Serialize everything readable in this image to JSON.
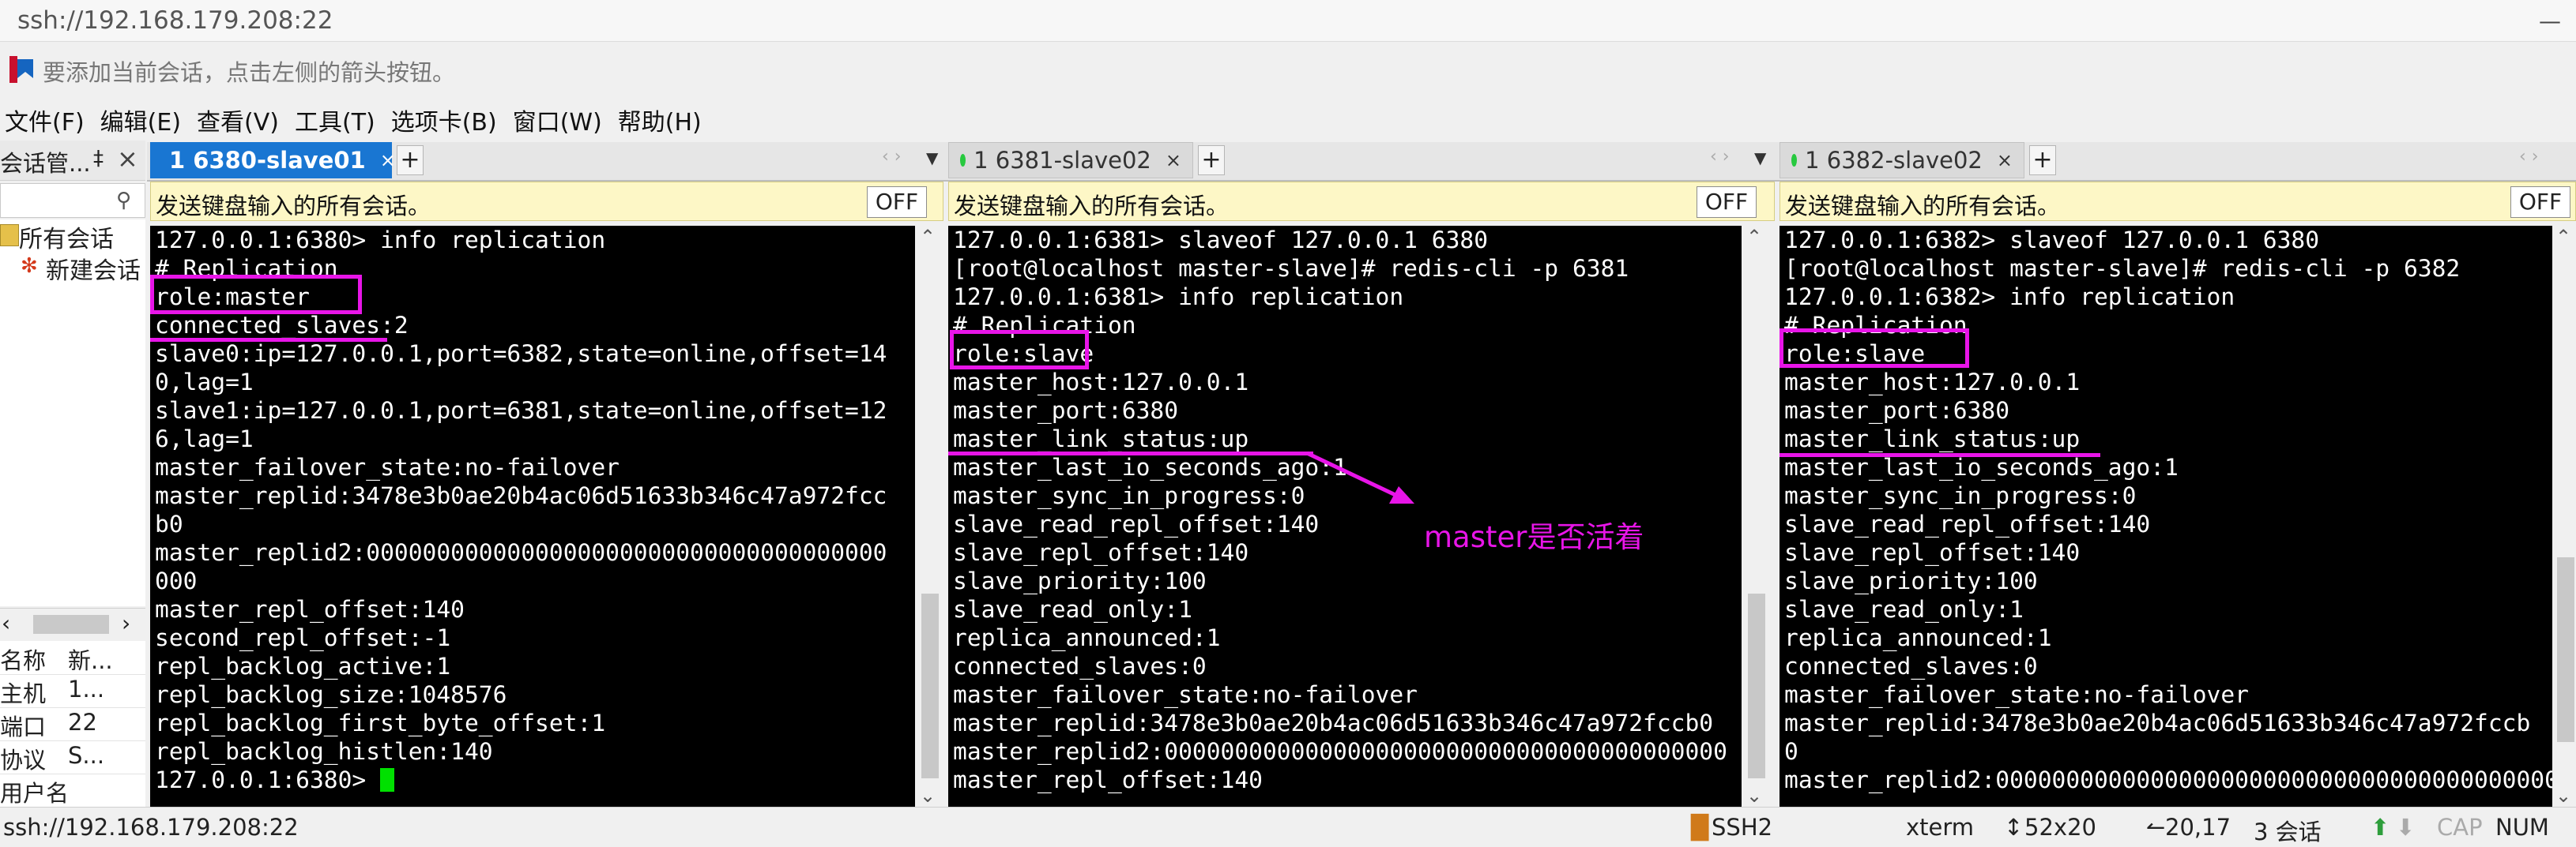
{
  "window": {
    "title": "ssh://192.168.179.208:22",
    "minimize_icon": "minimize-icon"
  },
  "info_bar": {
    "text": "要添加当前会话，点击左侧的箭头按钮。",
    "icon": "bookmark-icon"
  },
  "menu": [
    "文件(F)",
    "编辑(E)",
    "查看(V)",
    "工具(T)",
    "选项卡(B)",
    "窗口(W)",
    "帮助(H)"
  ],
  "session_manager": {
    "title": "会话管...",
    "pin": "‡",
    "close": "×",
    "tree": [
      {
        "label": "所有会话",
        "icon": "folder-icon"
      },
      {
        "label": "新建会话",
        "icon": "session-icon"
      }
    ],
    "properties": [
      {
        "key": "名称",
        "value": "新..."
      },
      {
        "key": "主机",
        "value": "1..."
      },
      {
        "key": "端口",
        "value": "22"
      },
      {
        "key": "协议",
        "value": "S..."
      },
      {
        "key": "用户名",
        "value": ""
      }
    ]
  },
  "panes": [
    {
      "tab_label": "1 6380-slave01",
      "tab_active": true,
      "send_all_text": "发送键盘输入的所有会话。",
      "off_label": "OFF",
      "lines": [
        "127.0.0.1:6380> info replication",
        "# Replication",
        "role:master",
        "connected_slaves:2",
        "slave0:ip=127.0.0.1,port=6382,state=online,offset=14",
        "0,lag=1",
        "slave1:ip=127.0.0.1,port=6381,state=online,offset=12",
        "6,lag=1",
        "master_failover_state:no-failover",
        "master_replid:3478e3b0ae20b4ac06d51633b346c47a972fcc",
        "b0",
        "master_replid2:0000000000000000000000000000000000000",
        "000",
        "master_repl_offset:140",
        "second_repl_offset:-1",
        "repl_backlog_active:1",
        "repl_backlog_size:1048576",
        "repl_backlog_first_byte_offset:1",
        "repl_backlog_histlen:140",
        "127.0.0.1:6380> "
      ]
    },
    {
      "tab_label": "1 6381-slave02",
      "tab_active": false,
      "send_all_text": "发送键盘输入的所有会话。",
      "off_label": "OFF",
      "lines": [
        "127.0.0.1:6381> slaveof 127.0.0.1 6380",
        "[root@localhost master-slave]# redis-cli -p 6381",
        "127.0.0.1:6381> info replication",
        "# Replication",
        "role:slave",
        "master_host:127.0.0.1",
        "master_port:6380",
        "master_link_status:up",
        "master_last_io_seconds_ago:1",
        "master_sync_in_progress:0",
        "slave_read_repl_offset:140",
        "slave_repl_offset:140",
        "slave_priority:100",
        "slave_read_only:1",
        "replica_announced:1",
        "connected_slaves:0",
        "master_failover_state:no-failover",
        "master_replid:3478e3b0ae20b4ac06d51633b346c47a972fccb0",
        "master_replid2:0000000000000000000000000000000000000000",
        "master_repl_offset:140"
      ],
      "annotation": "master是否活着"
    },
    {
      "tab_label": "1 6382-slave02",
      "tab_active": false,
      "send_all_text": "发送键盘输入的所有会话。",
      "off_label": "OFF",
      "lines": [
        "127.0.0.1:6382> slaveof 127.0.0.1 6380",
        "[root@localhost master-slave]# redis-cli -p 6382",
        "127.0.0.1:6382> info replication",
        "# Replication",
        "role:slave",
        "master_host:127.0.0.1",
        "master_port:6380",
        "master_link_status:up",
        "master_last_io_seconds_ago:1",
        "master_sync_in_progress:0",
        "slave_read_repl_offset:140",
        "slave_repl_offset:140",
        "slave_priority:100",
        "slave_read_only:1",
        "replica_announced:1",
        "connected_slaves:0",
        "master_failover_state:no-failover",
        "master_replid:3478e3b0ae20b4ac06d51633b346c47a972fccb",
        "0",
        "master_replid2:0000000000000000000000000000000000000000"
      ]
    }
  ],
  "status_bar": {
    "connection": "ssh://192.168.179.208:22",
    "protocol": "SSH2",
    "terminal": "xterm",
    "size": "52x20",
    "position": "20,17",
    "sessions": "3 会话",
    "caps": "CAP",
    "num": "NUM"
  },
  "colors": {
    "highlight": "#e815e8",
    "active_tab": "#1976d2",
    "cursor": "#00e000",
    "send_bar": "#fdf7c6"
  }
}
